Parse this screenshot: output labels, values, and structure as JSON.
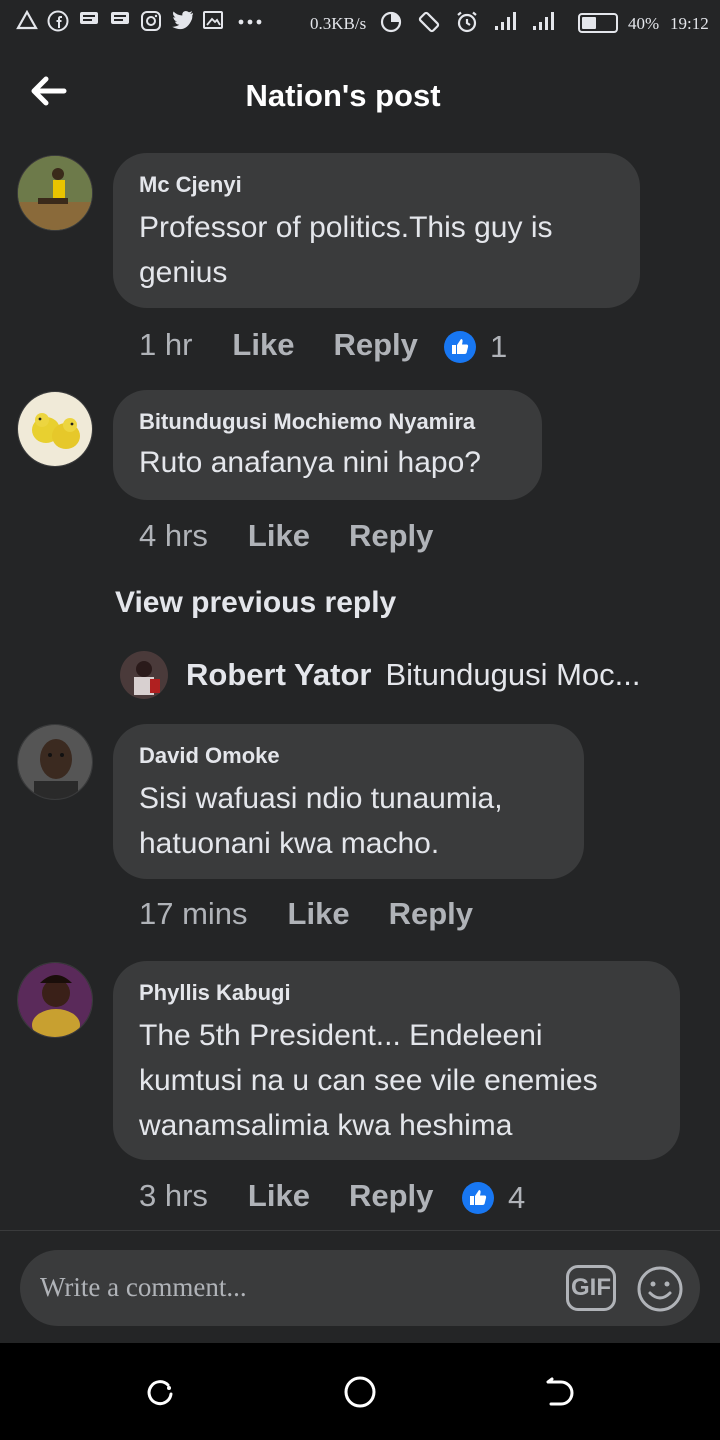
{
  "status_bar": {
    "left_icons": [
      "alert-triangle-icon",
      "facebook-icon",
      "message-icon",
      "message-icon",
      "instagram-icon",
      "twitter-icon",
      "image-icon",
      "more-icon"
    ],
    "net_speed": "0.3KB/s",
    "battery_pct": "40%",
    "time": "19:12"
  },
  "header": {
    "title": "Nation's post"
  },
  "comments": [
    {
      "author": "Mc Cjenyi",
      "text": "Professor of politics.This guy is genius",
      "time": "1 hr",
      "like": "Like",
      "reply": "Reply",
      "reactions": "1"
    },
    {
      "author": "Bitundugusi Mochiemo Nyamira",
      "text": "Ruto anafanya nini hapo?",
      "time": "4 hrs",
      "like": "Like",
      "reply": "Reply"
    },
    {
      "author": "David Omoke",
      "text": "Sisi wafuasi ndio tunaumia, hatuonani kwa macho.",
      "time": "17 mins",
      "like": "Like",
      "reply": "Reply"
    },
    {
      "author": "Phyllis Kabugi",
      "text": "The 5th President... Endeleeni kumtusi na u can see vile enemies wanamsalimia kwa heshima",
      "time": "3 hrs",
      "like": "Like",
      "reply": "Reply",
      "reactions": "4"
    }
  ],
  "view_previous_reply": "View previous reply",
  "reply_preview": {
    "author": "Robert Yator",
    "text": "Bitundugusi Moc..."
  },
  "composer": {
    "placeholder": "Write a comment...",
    "gif_label": "GIF"
  },
  "colors": {
    "background": "#242526",
    "bubble": "#3a3b3c",
    "like_blue": "#1877f2",
    "secondary_text": "#b0b3b8"
  }
}
